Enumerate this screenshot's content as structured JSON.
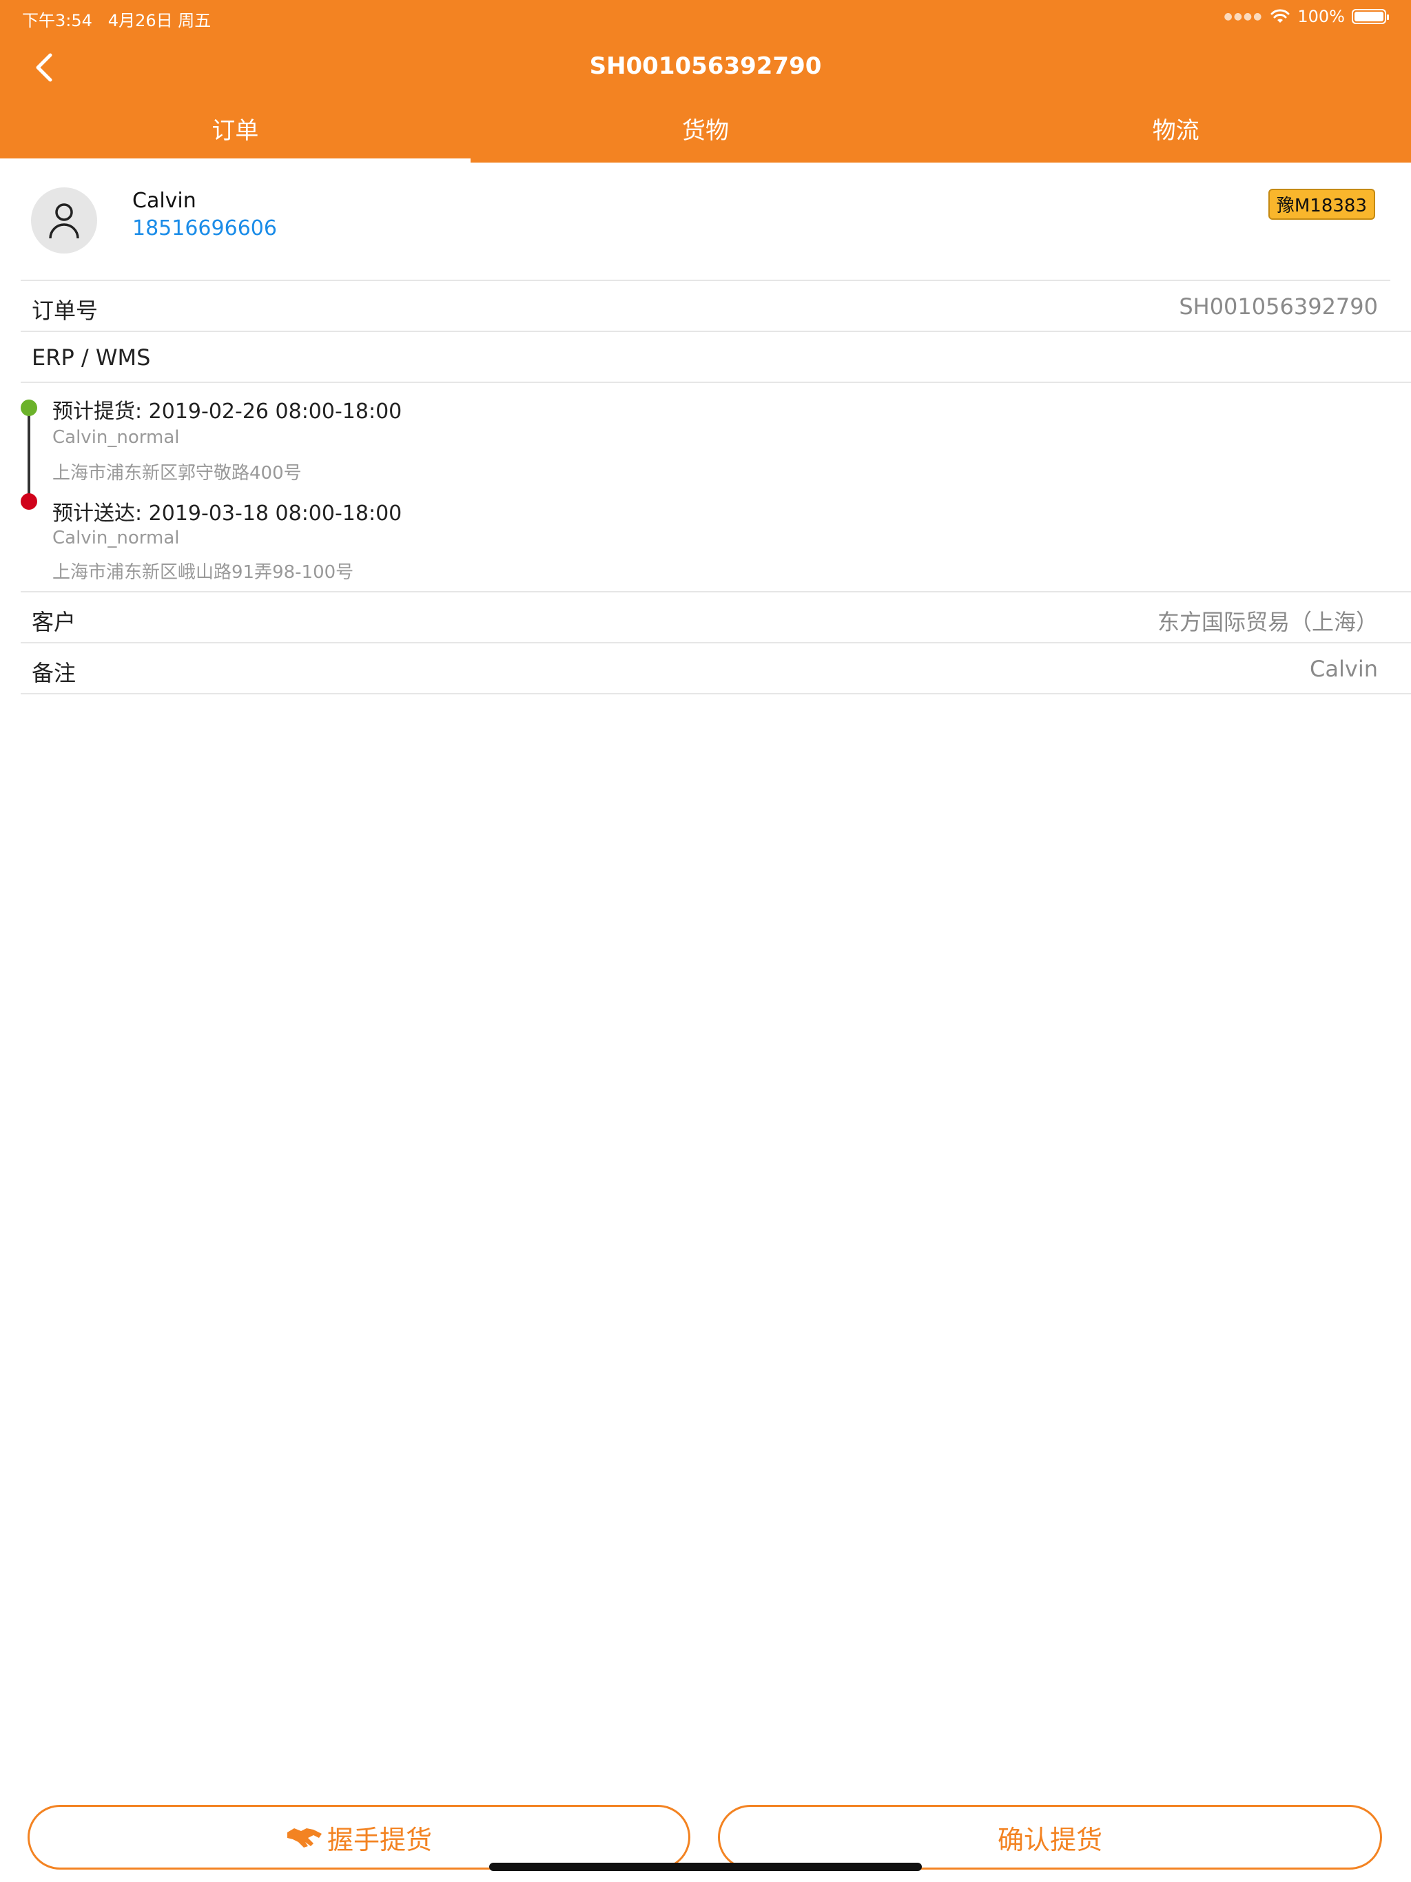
{
  "status_bar": {
    "time": "下午3:54",
    "date": "4月26日 周五",
    "battery": "100%",
    "battery_level": 1.0
  },
  "nav": {
    "title": "SH001056392790",
    "back_icon": "chevron-left-icon"
  },
  "tabs": [
    {
      "label": "订单",
      "active": true
    },
    {
      "label": "货物",
      "active": false
    },
    {
      "label": "物流",
      "active": false
    }
  ],
  "user": {
    "name": "Calvin",
    "phone": "18516696606",
    "plate": "豫M18383",
    "avatar_icon": "user-icon"
  },
  "order": {
    "number_label": "订单号",
    "number_value": "SH001056392790",
    "erp_label": "ERP / WMS"
  },
  "timeline": {
    "pickup_title": "预计提货: 2019-02-26 08:00-18:00",
    "pickup_contact": "Calvin_normal",
    "pickup_address": "上海市浦东新区郭守敬路400号",
    "delivery_title": "预计送达: 2019-03-18 08:00-18:00",
    "delivery_contact": "Calvin_normal",
    "delivery_address": "上海市浦东新区峨山路91弄98-100号"
  },
  "customer": {
    "label": "客户",
    "value": "东方国际贸易（上海）"
  },
  "remark": {
    "label": "备注",
    "value": "Calvin"
  },
  "actions": {
    "handshake_label": "握手提货",
    "handshake_icon": "handshake-icon",
    "confirm_label": "确认提货"
  },
  "colors": {
    "primary": "#F38322",
    "link": "#1A8CE8",
    "plate_badge": "#F9B62C",
    "pickup_dot": "#6BB22A",
    "delivery_dot": "#D0021B"
  }
}
